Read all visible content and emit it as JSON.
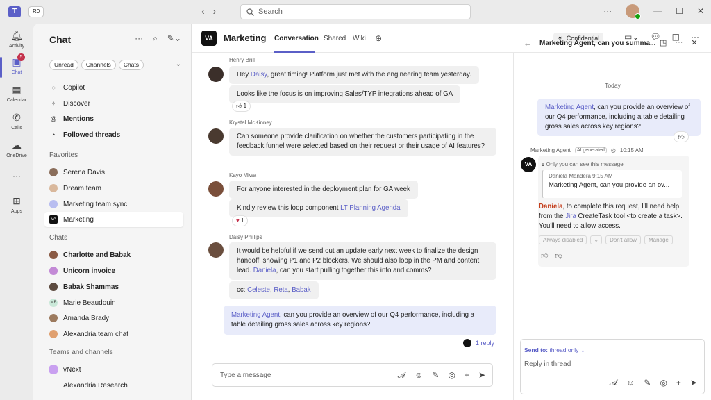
{
  "app": {
    "account": "R0",
    "search_placeholder": "Search"
  },
  "rail": [
    {
      "label": "Activity",
      "icon": "bell-icon"
    },
    {
      "label": "Chat",
      "icon": "chat-icon",
      "badge": "5"
    },
    {
      "label": "Calendar",
      "icon": "calendar-icon"
    },
    {
      "label": "Calls",
      "icon": "phone-icon"
    },
    {
      "label": "OneDrive",
      "icon": "cloud-icon"
    },
    {
      "label": "Apps",
      "icon": "apps-icon"
    }
  ],
  "left": {
    "title": "Chat",
    "filters": [
      "Unread",
      "Channels",
      "Chats"
    ],
    "top_items": [
      {
        "label": "Copilot",
        "icon": "copilot-icon"
      },
      {
        "label": "Discover",
        "icon": "sparkle-icon"
      },
      {
        "label": "Mentions",
        "icon": "at-icon"
      },
      {
        "label": "Followed threads",
        "icon": "followed-icon"
      }
    ],
    "favorites_label": "Favorites",
    "favorites": [
      "Serena Davis",
      "Dream team",
      "Marketing team sync",
      "Marketing"
    ],
    "chats_label": "Chats",
    "chats": [
      "Charlotte and Babak",
      "Unicorn invoice",
      "Babak Shammas",
      "Marie Beaudouin",
      "Amanda Brady",
      "Alexandria team chat"
    ],
    "teams_label": "Teams and channels",
    "teams": [
      "vNext",
      "Alexandria Research"
    ]
  },
  "channel": {
    "name": "Marketing",
    "logo_text": "VA",
    "tabs": [
      "Conversation",
      "Shared",
      "Wiki"
    ],
    "confidential": "Confidential"
  },
  "messages": [
    {
      "author": "Henry Brill",
      "lines": [
        "Hey Daisy, great timing! Platform just met with the engineering team yesterday.",
        "Looks like the focus is on improving Sales/TYP integrations ahead of GA"
      ],
      "reaction": "1"
    },
    {
      "author": "Krystal McKinney",
      "text": "Can someone provide clarification on whether the customers participating in the feedback funnel were selected based on their request or their usage of AI features?"
    },
    {
      "author": "Kayo Miwa",
      "lines": [
        "For anyone interested in the deployment plan for GA week",
        "Kindly review this loop component"
      ],
      "link": "LT Planning Agenda",
      "reaction": "1"
    },
    {
      "author": "Daisy Phillips",
      "text": "It would be helpful if we send out an update early next week to finalize the design handoff, showing P1 and P2 blockers. We should also loop in the PM and content lead. Daniela, can you start pulling together this info and comms?",
      "cc": "cc: Celeste, Reta, Babak"
    },
    {
      "mine": "Marketing Agent, can you provide an overview of our Q4 performance, including a table detailing gross sales across key regions?",
      "replies": "1 reply"
    }
  ],
  "compose_placeholder": "Type a message",
  "thread": {
    "title": "Marketing Agent, can you summa...",
    "today": "Today",
    "question": "Marketing Agent, can you provide an overview of our Q4 performance, including a table detailing gross sales across key regions?",
    "agent": "Marketing Agent",
    "ai_tag": "AI generated",
    "time": "10:15 AM",
    "only_you": "Only you can see this message",
    "quote_author": "Daniela Mandera 9:15 AM",
    "quote_text": "Marketing Agent, can you provide an ov...",
    "reply": "Daniela, to complete this request, I'll need help from the Jira CreateTask tool <to create a task>. You'll need to allow access.",
    "buttons": [
      "Always disabled",
      "Don't allow",
      "Manage"
    ],
    "send_to": "Send to:",
    "send_to_value": "thread only",
    "reply_placeholder": "Reply in thread"
  }
}
